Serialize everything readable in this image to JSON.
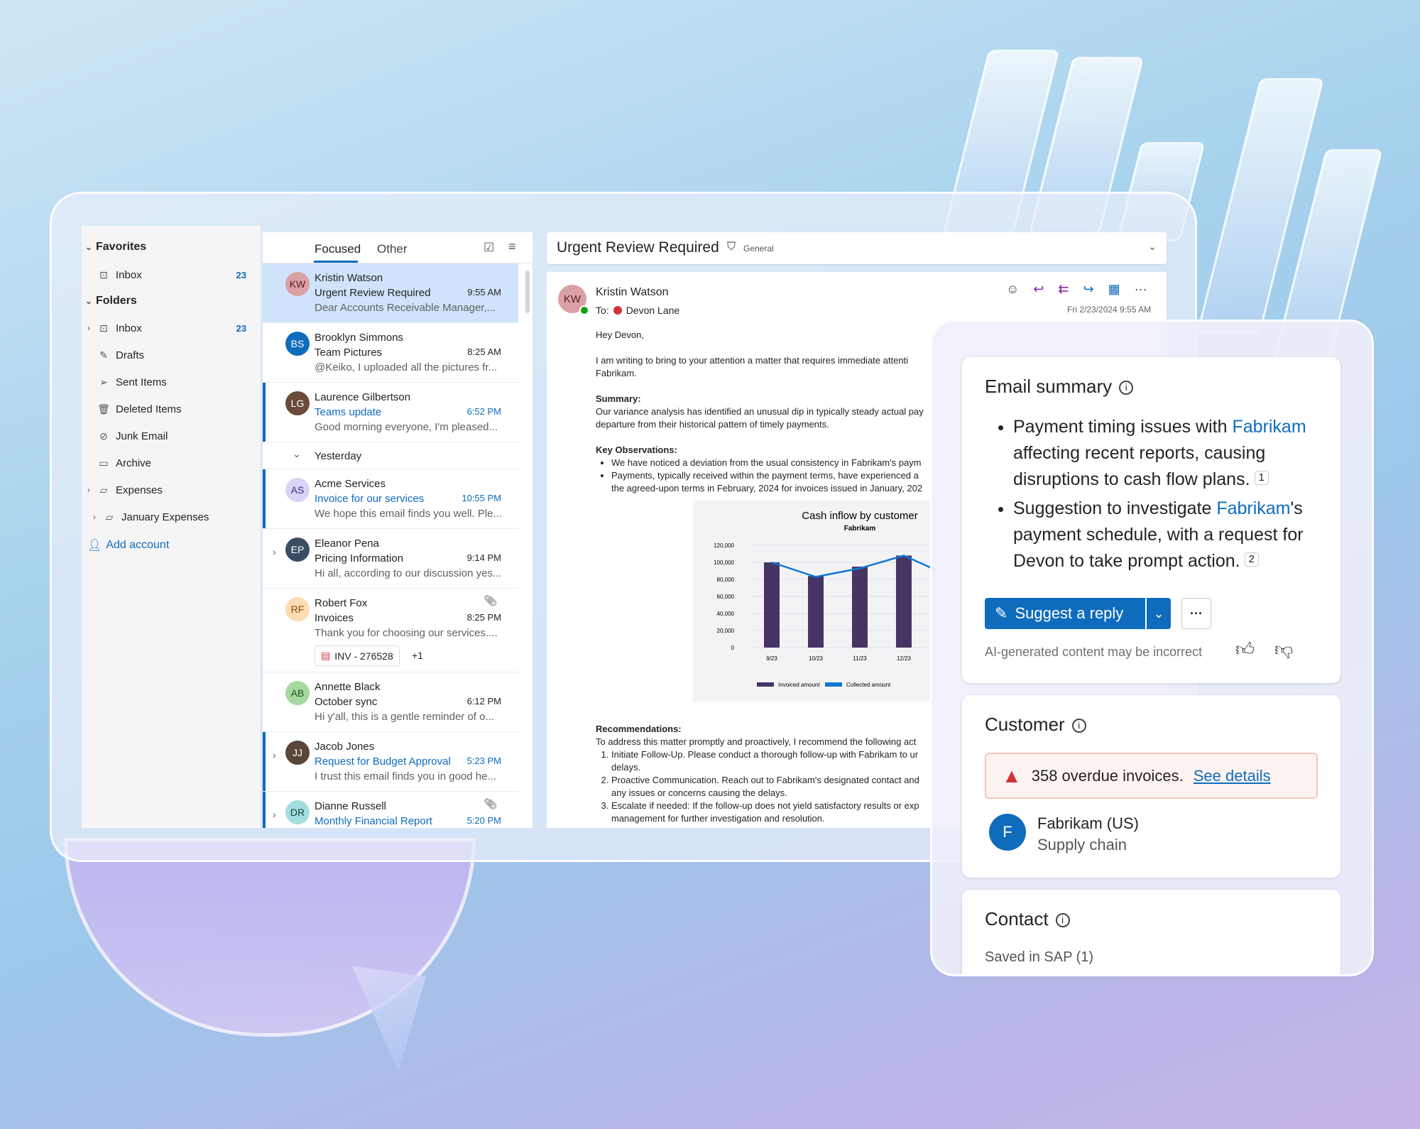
{
  "colors": {
    "accent": "#0f6cbd",
    "chart_bar": "#463465",
    "chart_line": "#0f78d4",
    "alert": "#d13438"
  },
  "sidebar": {
    "favorites": "Favorites",
    "favorites_items": [
      {
        "label": "Inbox",
        "count": "23",
        "icon": "inbox-icon"
      }
    ],
    "folders": "Folders",
    "folder_items": [
      {
        "label": "Inbox",
        "count": "23",
        "icon": "inbox-icon",
        "expandable": true
      },
      {
        "label": "Drafts",
        "icon": "pencil-icon"
      },
      {
        "label": "Sent Items",
        "icon": "send-icon"
      },
      {
        "label": "Deleted Items",
        "icon": "trash-icon"
      },
      {
        "label": "Junk Email",
        "icon": "junk-icon"
      },
      {
        "label": "Archive",
        "icon": "archive-icon"
      },
      {
        "label": "Expenses",
        "icon": "folder-icon",
        "expandable": true
      },
      {
        "label": "January Expenses",
        "icon": "folder-icon",
        "expandable": true,
        "sub": true
      }
    ],
    "add_account": "Add account"
  },
  "list": {
    "tabs": [
      "Focused",
      "Other"
    ],
    "yesterday": "Yesterday",
    "messages": [
      {
        "initials": "KW",
        "name": "Kristin Watson",
        "subject": "Urgent Review Required",
        "time": "9:55 AM",
        "preview": "Dear Accounts Receivable Manager,...",
        "avatar": "#dba1a6",
        "avatar_text": "#5a1a20",
        "selected": true
      },
      {
        "initials": "BS",
        "name": "Brooklyn Simmons",
        "subject": "Team Pictures",
        "time": "8:25 AM",
        "preview": "@Keiko, I uploaded all the pictures fr...",
        "avatar": "#0f6cbd",
        "avatar_text": "#ffffff"
      },
      {
        "initials": "LG",
        "name": "Laurence Gilbertson",
        "subject": "Teams update",
        "time": "6:52 PM",
        "preview": "Good morning everyone, I'm pleased...",
        "avatar": "#6b4a3a",
        "avatar_text": "#ffffff",
        "unread": true,
        "photo": true
      },
      {
        "divider": true
      },
      {
        "initials": "AS",
        "name": "Acme Services",
        "subject": "Invoice for our services",
        "time": "10:55 PM",
        "preview": "We hope this email finds you well. Ple...",
        "avatar": "#d9d3f5",
        "avatar_text": "#3b2a8a",
        "unread": true
      },
      {
        "initials": "EP",
        "name": "Eleanor Pena",
        "subject": "Pricing Information",
        "time": "9:14 PM",
        "preview": "Hi all, according to our discussion yes...",
        "avatar": "#3a4d63",
        "avatar_text": "#ffffff",
        "thread": true,
        "photo": true
      },
      {
        "initials": "RF",
        "name": "Robert Fox",
        "subject": "Invoices",
        "time": "8:25 PM",
        "preview": "Thank you for choosing our services....",
        "avatar": "#fcdcb4",
        "avatar_text": "#8a4a00",
        "attachment": true,
        "file": "INV - 276528",
        "more": "+1"
      },
      {
        "initials": "AB",
        "name": "Annette Black",
        "subject": "October sync",
        "time": "6:12 PM",
        "preview": "Hi y'all, this is a gentle reminder of o...",
        "avatar": "#a6d8a0",
        "avatar_text": "#14501a"
      },
      {
        "initials": "JJ",
        "name": "Jacob Jones",
        "subject": "Request for Budget Approval",
        "time": "5:23 PM",
        "preview": "I trust this email finds you in good he...",
        "avatar": "#5a4638",
        "avatar_text": "#ffffff",
        "unread": true,
        "thread": true,
        "photo": true
      },
      {
        "initials": "DR",
        "name": "Dianne Russell",
        "subject": "Monthly Financial Report",
        "time": "5:20 PM",
        "preview": "",
        "avatar": "#a3dede",
        "avatar_text": "#0d4a4a",
        "unread": true,
        "thread": true,
        "attachment": true
      }
    ]
  },
  "reading": {
    "subject": "Urgent Review Required",
    "label": "General",
    "sender": "Kristin Watson",
    "initials": "KW",
    "to_label": "To:",
    "to": "Devon Lane",
    "date": "Fri 2/23/2024 9:55 AM",
    "greeting": "Hey Devon,",
    "intro": [
      "I am writing to bring to your attention a matter that requires immediate attenti",
      "Fabrikam."
    ],
    "summary_h": "Summary:",
    "summary": [
      "Our variance analysis has identified an unusual dip in typically steady actual pay",
      "departure from their historical pattern of timely payments."
    ],
    "obs_h": "Key Observations:",
    "obs": [
      "We have noticed a deviation from the usual consistency in Fabrikam's paym",
      "Payments, typically received within the payment terms, have experienced a"
    ],
    "obs_cont": "the agreed-upon terms in February, 2024 for invoices issued in January, 202",
    "rec_h": "Recommendations:",
    "rec_intro": "To address this matter promptly and proactively, I recommend the following act",
    "recs": [
      [
        "Initiate Follow-Up. Please conduct a thorough follow-up with Fabrikam to ur",
        "delays."
      ],
      [
        "Proactive Communication. Reach out to Fabrikam's designated contact and",
        "any issues or concerns causing the delays."
      ],
      [
        "Escalate if needed: If the follow-up does not yield satisfactory results or exp",
        "management for further investigation and resolution."
      ]
    ]
  },
  "chart_data": {
    "type": "bar",
    "title": "Cash inflow by customer",
    "subtitle": "Fabrikam",
    "categories": [
      "9/23",
      "10/23",
      "11/23",
      "12/23"
    ],
    "series": [
      {
        "name": "Invoiced amount",
        "type": "bar",
        "values": [
          100000,
          84000,
          95000,
          108000
        ]
      },
      {
        "name": "Collected amount",
        "type": "line",
        "values": [
          100000,
          83000,
          93000,
          108000
        ]
      }
    ],
    "yticks": [
      "0",
      "20,000",
      "40,000",
      "60,000",
      "80,000",
      "100,000",
      "120,000"
    ],
    "ylim": [
      0,
      120000
    ],
    "grid": true,
    "legend": "bottom"
  },
  "panel": {
    "summary_title": "Email summary",
    "bullets": [
      {
        "pre": "Payment timing issues with ",
        "link": "Fabrikam",
        "post": " affecting recent reports, causing disruptions to cash flow plans.",
        "ref": "1"
      },
      {
        "pre": "Suggestion to investigate ",
        "link": "Fabrikam",
        "post": "'s payment schedule, with a request for Devon to take prompt action.",
        "ref": "2"
      }
    ],
    "suggest": "Suggest a reply",
    "more": "···",
    "disclaimer": "AI-generated content may be incorrect",
    "customer_title": "Customer",
    "alert": "358 overdue invoices.",
    "alert_link": "See details",
    "company_initial": "F",
    "company": "Fabrikam (US)",
    "company_sub": "Supply chain",
    "contact_title": "Contact",
    "contact_sub": "Saved in SAP (1)"
  }
}
